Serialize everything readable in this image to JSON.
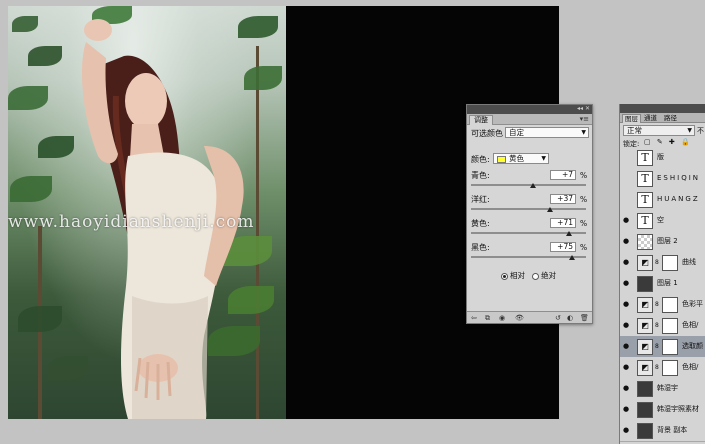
{
  "watermark": "www.haoyidianshenji.com",
  "adjustments_panel": {
    "tab": "调整",
    "preset_label": "可选颜色",
    "preset_value": "自定",
    "color_label": "颜色:",
    "color_value": "黄色",
    "color_swatch": "#ffff33",
    "sliders": [
      {
        "label": "青色:",
        "value": "+7",
        "unit": "%",
        "level": 0.535
      },
      {
        "label": "洋红:",
        "value": "+37",
        "unit": "%",
        "level": 0.685
      },
      {
        "label": "黄色:",
        "value": "+71",
        "unit": "%",
        "level": 0.855
      },
      {
        "label": "黑色:",
        "value": "+75",
        "unit": "%",
        "level": 0.875
      }
    ],
    "method_relative": "相对",
    "method_absolute": "绝对",
    "method_selected": "relative"
  },
  "layers_panel": {
    "tabs": [
      "图层",
      "通道",
      "路径"
    ],
    "blend_mode": "正常",
    "opacity_label": "不",
    "lock_label": "锁定:",
    "layers": [
      {
        "type": "text",
        "name": "版"
      },
      {
        "type": "text",
        "name": "ESHIQIN"
      },
      {
        "type": "text",
        "name": "HUANGZ"
      },
      {
        "type": "text",
        "name": "空"
      },
      {
        "type": "checker",
        "name": "图层 2"
      },
      {
        "type": "adj",
        "name": "曲线"
      },
      {
        "type": "photo",
        "name": "图层 1"
      },
      {
        "type": "adj",
        "name": "色彩平"
      },
      {
        "type": "adj",
        "name": "色相/"
      },
      {
        "type": "adj",
        "name": "选取颜",
        "selected": true
      },
      {
        "type": "adj",
        "name": "色相/"
      },
      {
        "type": "photo",
        "name": "韩湿宇"
      },
      {
        "type": "photo",
        "name": "韩湿宇照素材"
      },
      {
        "type": "photo",
        "name": "背景 副本"
      }
    ]
  }
}
